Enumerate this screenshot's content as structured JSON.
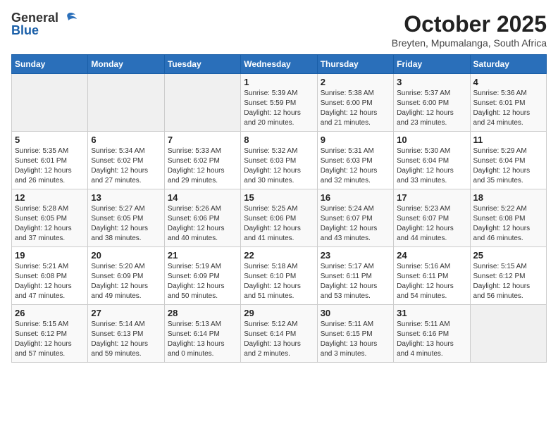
{
  "logo": {
    "general": "General",
    "blue": "Blue"
  },
  "title": "October 2025",
  "location": "Breyten, Mpumalanga, South Africa",
  "weekdays": [
    "Sunday",
    "Monday",
    "Tuesday",
    "Wednesday",
    "Thursday",
    "Friday",
    "Saturday"
  ],
  "weeks": [
    [
      {
        "day": "",
        "info": ""
      },
      {
        "day": "",
        "info": ""
      },
      {
        "day": "",
        "info": ""
      },
      {
        "day": "1",
        "info": "Sunrise: 5:39 AM\nSunset: 5:59 PM\nDaylight: 12 hours\nand 20 minutes."
      },
      {
        "day": "2",
        "info": "Sunrise: 5:38 AM\nSunset: 6:00 PM\nDaylight: 12 hours\nand 21 minutes."
      },
      {
        "day": "3",
        "info": "Sunrise: 5:37 AM\nSunset: 6:00 PM\nDaylight: 12 hours\nand 23 minutes."
      },
      {
        "day": "4",
        "info": "Sunrise: 5:36 AM\nSunset: 6:01 PM\nDaylight: 12 hours\nand 24 minutes."
      }
    ],
    [
      {
        "day": "5",
        "info": "Sunrise: 5:35 AM\nSunset: 6:01 PM\nDaylight: 12 hours\nand 26 minutes."
      },
      {
        "day": "6",
        "info": "Sunrise: 5:34 AM\nSunset: 6:02 PM\nDaylight: 12 hours\nand 27 minutes."
      },
      {
        "day": "7",
        "info": "Sunrise: 5:33 AM\nSunset: 6:02 PM\nDaylight: 12 hours\nand 29 minutes."
      },
      {
        "day": "8",
        "info": "Sunrise: 5:32 AM\nSunset: 6:03 PM\nDaylight: 12 hours\nand 30 minutes."
      },
      {
        "day": "9",
        "info": "Sunrise: 5:31 AM\nSunset: 6:03 PM\nDaylight: 12 hours\nand 32 minutes."
      },
      {
        "day": "10",
        "info": "Sunrise: 5:30 AM\nSunset: 6:04 PM\nDaylight: 12 hours\nand 33 minutes."
      },
      {
        "day": "11",
        "info": "Sunrise: 5:29 AM\nSunset: 6:04 PM\nDaylight: 12 hours\nand 35 minutes."
      }
    ],
    [
      {
        "day": "12",
        "info": "Sunrise: 5:28 AM\nSunset: 6:05 PM\nDaylight: 12 hours\nand 37 minutes."
      },
      {
        "day": "13",
        "info": "Sunrise: 5:27 AM\nSunset: 6:05 PM\nDaylight: 12 hours\nand 38 minutes."
      },
      {
        "day": "14",
        "info": "Sunrise: 5:26 AM\nSunset: 6:06 PM\nDaylight: 12 hours\nand 40 minutes."
      },
      {
        "day": "15",
        "info": "Sunrise: 5:25 AM\nSunset: 6:06 PM\nDaylight: 12 hours\nand 41 minutes."
      },
      {
        "day": "16",
        "info": "Sunrise: 5:24 AM\nSunset: 6:07 PM\nDaylight: 12 hours\nand 43 minutes."
      },
      {
        "day": "17",
        "info": "Sunrise: 5:23 AM\nSunset: 6:07 PM\nDaylight: 12 hours\nand 44 minutes."
      },
      {
        "day": "18",
        "info": "Sunrise: 5:22 AM\nSunset: 6:08 PM\nDaylight: 12 hours\nand 46 minutes."
      }
    ],
    [
      {
        "day": "19",
        "info": "Sunrise: 5:21 AM\nSunset: 6:08 PM\nDaylight: 12 hours\nand 47 minutes."
      },
      {
        "day": "20",
        "info": "Sunrise: 5:20 AM\nSunset: 6:09 PM\nDaylight: 12 hours\nand 49 minutes."
      },
      {
        "day": "21",
        "info": "Sunrise: 5:19 AM\nSunset: 6:09 PM\nDaylight: 12 hours\nand 50 minutes."
      },
      {
        "day": "22",
        "info": "Sunrise: 5:18 AM\nSunset: 6:10 PM\nDaylight: 12 hours\nand 51 minutes."
      },
      {
        "day": "23",
        "info": "Sunrise: 5:17 AM\nSunset: 6:11 PM\nDaylight: 12 hours\nand 53 minutes."
      },
      {
        "day": "24",
        "info": "Sunrise: 5:16 AM\nSunset: 6:11 PM\nDaylight: 12 hours\nand 54 minutes."
      },
      {
        "day": "25",
        "info": "Sunrise: 5:15 AM\nSunset: 6:12 PM\nDaylight: 12 hours\nand 56 minutes."
      }
    ],
    [
      {
        "day": "26",
        "info": "Sunrise: 5:15 AM\nSunset: 6:12 PM\nDaylight: 12 hours\nand 57 minutes."
      },
      {
        "day": "27",
        "info": "Sunrise: 5:14 AM\nSunset: 6:13 PM\nDaylight: 12 hours\nand 59 minutes."
      },
      {
        "day": "28",
        "info": "Sunrise: 5:13 AM\nSunset: 6:14 PM\nDaylight: 13 hours\nand 0 minutes."
      },
      {
        "day": "29",
        "info": "Sunrise: 5:12 AM\nSunset: 6:14 PM\nDaylight: 13 hours\nand 2 minutes."
      },
      {
        "day": "30",
        "info": "Sunrise: 5:11 AM\nSunset: 6:15 PM\nDaylight: 13 hours\nand 3 minutes."
      },
      {
        "day": "31",
        "info": "Sunrise: 5:11 AM\nSunset: 6:16 PM\nDaylight: 13 hours\nand 4 minutes."
      },
      {
        "day": "",
        "info": ""
      }
    ]
  ]
}
